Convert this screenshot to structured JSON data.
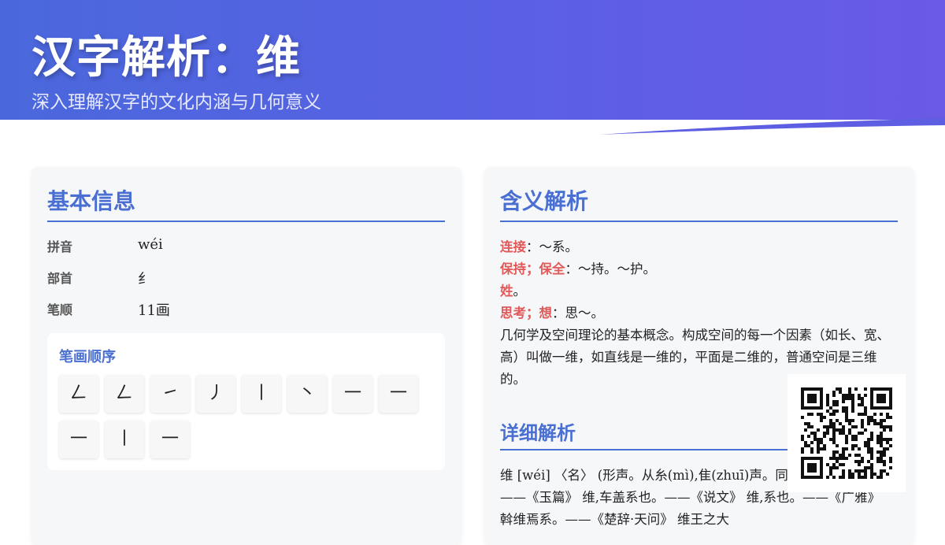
{
  "header": {
    "title": "汉字解析：维",
    "subtitle": "深入理解汉字的文化内涵与几何意义"
  },
  "basic": {
    "title": "基本信息",
    "rows": [
      {
        "label": "拼音",
        "value": "wéi"
      },
      {
        "label": "部首",
        "value": "纟"
      },
      {
        "label": "笔顺",
        "value": "11画"
      }
    ],
    "strokes_title": "笔画顺序",
    "strokes": [
      "𠃋",
      "𠃋",
      "㇀",
      "丿",
      "丨",
      "丶",
      "一",
      "一",
      "一",
      "丨",
      "一"
    ]
  },
  "meaning": {
    "title": "含义解析",
    "items": [
      {
        "term": "连接",
        "text": "：～系。"
      },
      {
        "term": "保持；保全",
        "text": "：～持。～护。"
      },
      {
        "term": "姓",
        "text": "。"
      },
      {
        "term": "思考；想",
        "text": "：思～。"
      }
    ],
    "paragraph": "几何学及空间理论的基本概念。构成空间的每一个因素（如长、宽、高）叫做一维，如直线是一维的，平面是二维的，普通空间是三维的。"
  },
  "detail": {
    "title": "详细解析",
    "text": "维 [wéi] 〈名〉 (形声。从糸(mì),隹(zhuī)声。同本义 维,紘也。——《玉篇》 维,车盖系也。——《说文》 维,系也。——《广雅》 斡维焉系。——《楚辞·天问》 维王之大"
  },
  "colors": {
    "accent": "#4a6fd2",
    "term": "#e05a5a",
    "header_start": "#4a68dc",
    "header_end": "#6a5ae6"
  }
}
